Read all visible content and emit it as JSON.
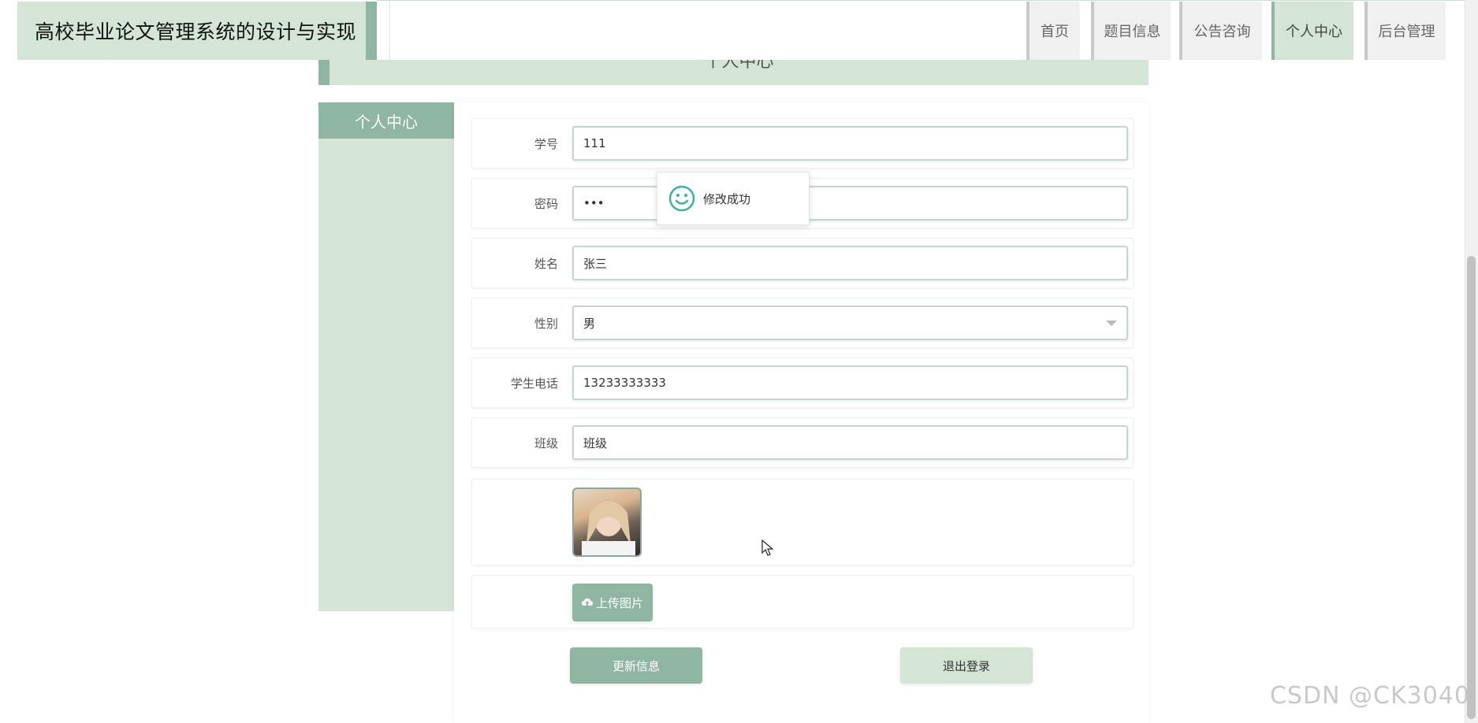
{
  "header": {
    "title": "高校毕业论文管理系统的设计与实现"
  },
  "nav": [
    {
      "label": "首页"
    },
    {
      "label": "题目信息"
    },
    {
      "label": "公告咨询"
    },
    {
      "label": "个人中心"
    },
    {
      "label": "后台管理"
    }
  ],
  "page": {
    "heading": "个人中心"
  },
  "sidebar": {
    "header": "个人中心"
  },
  "form": {
    "student_id": {
      "label": "学号",
      "value": "111"
    },
    "password": {
      "label": "密码",
      "value": "•••"
    },
    "name": {
      "label": "姓名",
      "value": "张三"
    },
    "gender": {
      "label": "性别",
      "value": "男"
    },
    "phone": {
      "label": "学生电话",
      "value": "13233333333"
    },
    "class": {
      "label": "班级",
      "value": "班级"
    },
    "upload_label": "上传图片",
    "update_label": "更新信息",
    "logout_label": "退出登录"
  },
  "toast": {
    "message": "修改成功"
  },
  "watermark": "CSDN @CK3040",
  "colors": {
    "accent": "#8fb5a3",
    "light": "#d4e5d5",
    "toast_icon": "#3bb39b"
  }
}
